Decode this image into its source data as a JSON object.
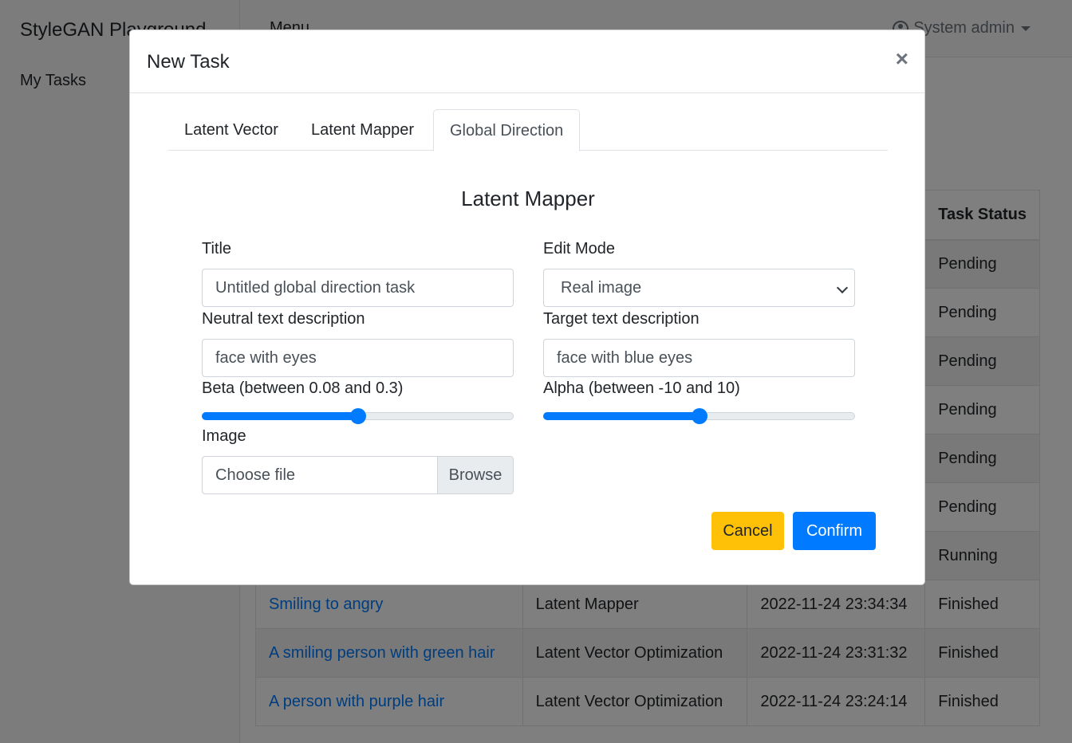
{
  "app": {
    "brand": "StyleGAN Playground",
    "sidebar_link": "My Tasks",
    "menu_label": "Menu",
    "user_label": "System admin"
  },
  "table": {
    "status_header": "Task Status",
    "rows": [
      {
        "title": "",
        "type": "",
        "created": "",
        "status": "Pending"
      },
      {
        "title": "",
        "type": "",
        "created": "",
        "status": "Pending"
      },
      {
        "title": "",
        "type": "",
        "created": "",
        "status": "Pending"
      },
      {
        "title": "",
        "type": "",
        "created": "",
        "status": "Pending"
      },
      {
        "title": "",
        "type": "",
        "created": "",
        "status": "Pending"
      },
      {
        "title": "",
        "type": "",
        "created": "",
        "status": "Pending"
      },
      {
        "title": "",
        "type": "",
        "created": "",
        "status": "Running"
      },
      {
        "title": "Smiling to angry",
        "type": "Latent Mapper",
        "created": "2022-11-24 23:34:34",
        "status": "Finished"
      },
      {
        "title": "A smiling person with green hair",
        "type": "Latent Vector Optimization",
        "created": "2022-11-24 23:31:32",
        "status": "Finished"
      },
      {
        "title": "A person with purple hair",
        "type": "Latent Vector Optimization",
        "created": "2022-11-24 23:24:14",
        "status": "Finished"
      }
    ]
  },
  "modal": {
    "title": "New Task",
    "close_symbol": "×",
    "tabs": [
      {
        "label": "Latent Vector",
        "active": false
      },
      {
        "label": "Latent Mapper",
        "active": false
      },
      {
        "label": "Global Direction",
        "active": true
      }
    ],
    "heading": "Latent Mapper",
    "form": {
      "title_label": "Title",
      "title_value": "Untitled global direction task",
      "edit_mode_label": "Edit Mode",
      "edit_mode_value": "Real image",
      "neutral_label": "Neutral text description",
      "neutral_value": "face with eyes",
      "target_label": "Target text description",
      "target_value": "face with blue eyes",
      "beta_label": "Beta (between 0.08 and 0.3)",
      "beta_fraction": 0.5,
      "alpha_label": "Alpha (between -10 and 10)",
      "alpha_fraction": 0.5,
      "image_label": "Image",
      "file_placeholder": "Choose file",
      "browse_label": "Browse"
    },
    "buttons": {
      "cancel": "Cancel",
      "confirm": "Confirm"
    }
  },
  "colors": {
    "primary": "#007bff",
    "warning": "#ffc107"
  }
}
